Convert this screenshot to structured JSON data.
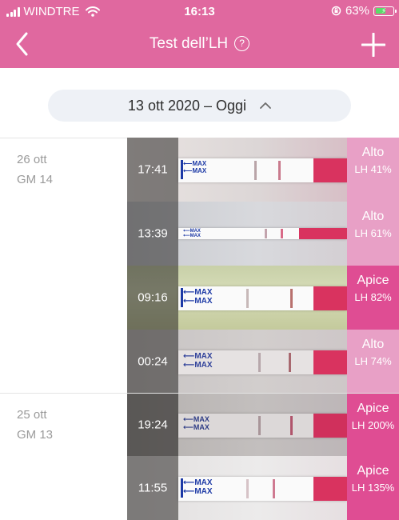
{
  "status": {
    "carrier": "WINDTRE",
    "time": "16:13",
    "battery": "63%",
    "battery_level": 0.63
  },
  "nav": {
    "title": "Test dell’LH",
    "help_icon": "question-circle-icon",
    "back_icon": "chevron-left-icon",
    "add_icon": "plus-icon"
  },
  "range": {
    "label": "13 ott 2020 – Oggi",
    "icon": "chevron-up-icon"
  },
  "days": [
    {
      "date": "26 ott",
      "cycle_day": "GM 14",
      "tests": [
        {
          "time": "17:41",
          "level": "Alto",
          "lh": "LH 41%"
        },
        {
          "time": "13:39",
          "level": "Alto",
          "lh": "LH 61%"
        },
        {
          "time": "09:16",
          "level": "Apice",
          "lh": "LH 82%"
        },
        {
          "time": "00:24",
          "level": "Alto",
          "lh": "LH 74%"
        }
      ]
    },
    {
      "date": "25 ott",
      "cycle_day": "GM 13",
      "tests": [
        {
          "time": "19:24",
          "level": "Apice",
          "lh": "LH 200%"
        },
        {
          "time": "11:55",
          "level": "Apice",
          "lh": "LH 135%"
        }
      ]
    }
  ],
  "colors": {
    "brand_pink": "#e0689f",
    "result_alto": "#e8a0c6",
    "result_apice": "#df4d93",
    "range_bg": "#eef1f6"
  }
}
